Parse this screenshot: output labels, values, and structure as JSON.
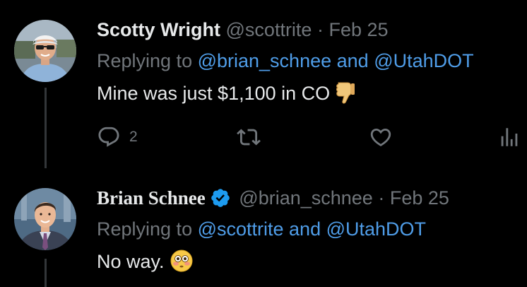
{
  "tweets": [
    {
      "display_name": "Scotty Wright",
      "handle": "@scottrite",
      "separator": "·",
      "date": "Feb 25",
      "replying_prefix": "Replying to ",
      "mention_1": "@brian_schnee",
      "joiner": " and ",
      "mention_2": "@UtahDOT",
      "text": "Mine was just $1,100 in CO",
      "emoji": "thumbs-down",
      "actions": {
        "reply_count": "2",
        "retweet_count": "",
        "like_count": "",
        "views_count": ""
      }
    },
    {
      "display_name": "Brian Schnee",
      "verified": true,
      "handle": "@brian_schnee",
      "separator": "·",
      "date": "Feb 25",
      "replying_prefix": "Replying to ",
      "mention_1": "@scottrite",
      "joiner": " and ",
      "mention_2": "@UtahDOT",
      "text": "No way.",
      "emoji": "flushed-face"
    }
  ],
  "colors": {
    "background": "#000000",
    "text_primary": "#e7e9ea",
    "text_secondary": "#71767b",
    "link": "#4f9de8",
    "verified": "#1d9bf0",
    "thread_line": "#333639"
  },
  "icons": [
    "reply-icon",
    "retweet-icon",
    "like-icon",
    "views-icon",
    "verified-badge-icon"
  ]
}
